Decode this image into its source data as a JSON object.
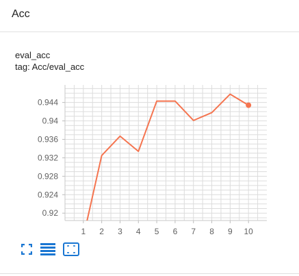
{
  "header": {
    "title": "Acc"
  },
  "card": {
    "title": "eval_acc",
    "tag": "tag: Acc/eval_acc"
  },
  "chart_data": {
    "type": "line",
    "title": "eval_acc",
    "x": [
      1,
      2,
      3,
      4,
      5,
      6,
      7,
      8,
      9,
      10
    ],
    "series": [
      {
        "values": [
          0.9148,
          0.9325,
          0.9367,
          0.9334,
          0.9443,
          0.9443,
          0.9401,
          0.9418,
          0.9458,
          0.9434
        ],
        "color": "#f5744f"
      }
    ],
    "x_ticks": [
      "1",
      "2",
      "3",
      "4",
      "5",
      "6",
      "7",
      "8",
      "9",
      "10"
    ],
    "y_ticks": [
      "0.92",
      "0.924",
      "0.928",
      "0.932",
      "0.936",
      "0.94",
      "0.944"
    ],
    "xlim": [
      0,
      11
    ],
    "ylim": [
      0.9184,
      0.9478
    ],
    "grid": true,
    "xlabel": "",
    "ylabel": ""
  },
  "toolbar": {
    "icons": [
      "fullscreen-icon",
      "list-icon",
      "fit-domain-icon"
    ],
    "accent": "#1976d2"
  }
}
